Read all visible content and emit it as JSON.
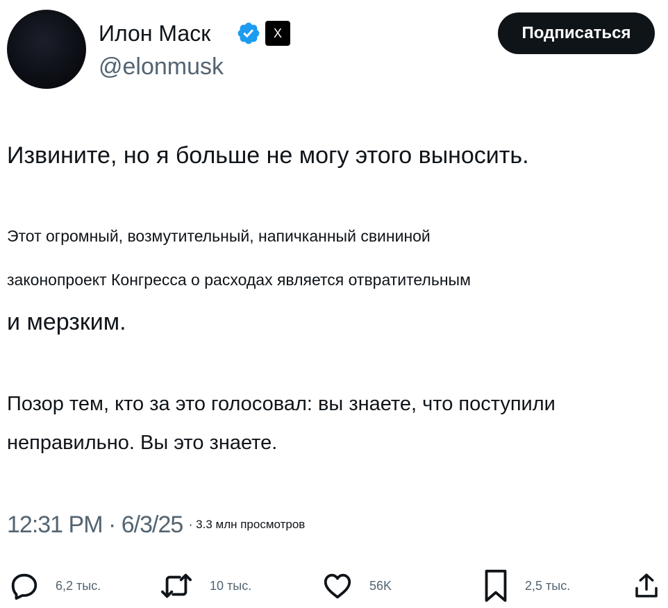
{
  "author": {
    "display_name": "Илон Маск",
    "handle": "@elonmusk",
    "affiliation_badge": "X",
    "verified_icon": "verified-badge-icon",
    "verified_color": "#1d9bf0"
  },
  "follow_button": {
    "label": "Подписаться"
  },
  "tweet": {
    "lines": [
      "Извините, но я больше не могу этого выносить.",
      "Этот огромный, возмутительный, напичканный свининой",
      "законопроект Конгресса о расходах является отвратительным",
      "и мерзким.",
      "Позор тем, кто за это голосовал: вы знаете, что поступили",
      "неправильно. Вы это знаете."
    ]
  },
  "meta": {
    "time": "12:31 PM",
    "date": "6/3/25",
    "separator": "·",
    "views": "3.3 млн просмотров"
  },
  "actions": {
    "reply": {
      "count": "6,2 тыс.",
      "icon": "reply-icon"
    },
    "retweet": {
      "count": "10 тыс.",
      "icon": "retweet-icon"
    },
    "like": {
      "count": "56K",
      "icon": "heart-icon"
    },
    "bookmark": {
      "count": "2,5 тыс.",
      "icon": "bookmark-icon"
    },
    "share": {
      "icon": "share-icon"
    }
  }
}
